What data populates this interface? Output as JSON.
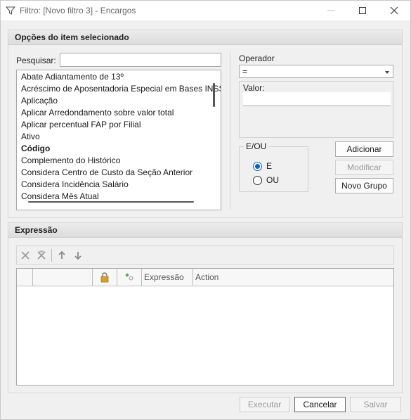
{
  "window": {
    "title": "Filtro: [Novo filtro 3] - Encargos"
  },
  "options_panel": {
    "header": "Opções do item selecionado",
    "search_label": "Pesquisar:",
    "search_value": "",
    "items": [
      {
        "label": "Abate Adiantamento de 13º",
        "bold": false
      },
      {
        "label": "Acréscimo de Aposentadoria Especial em Bases INSS",
        "bold": false
      },
      {
        "label": "Aplicação",
        "bold": false
      },
      {
        "label": "Aplicar Arredondamento sobre valor total",
        "bold": false
      },
      {
        "label": "Aplicar percentual FAP por Filial",
        "bold": false
      },
      {
        "label": "Ativo",
        "bold": false
      },
      {
        "label": "Código",
        "bold": true
      },
      {
        "label": "Complemento do Histórico",
        "bold": false
      },
      {
        "label": "Considera Centro de Custo da Seção Anterior",
        "bold": false
      },
      {
        "label": "Considera Incidência Salário",
        "bold": false
      },
      {
        "label": "Considera Mês Atual",
        "bold": false
      }
    ],
    "operator_label": "Operador",
    "operator_value": "=",
    "valor_label": "Valor:",
    "valor_value": "",
    "eou": {
      "title": "E/OU",
      "options": [
        "E",
        "OU"
      ],
      "selected": "E"
    },
    "buttons": {
      "adicionar": "Adicionar",
      "modificar": "Modificar",
      "novo_grupo": "Novo Grupo"
    }
  },
  "expression_panel": {
    "header": "Expressão",
    "columns": [
      "",
      "",
      "lock-icon",
      "toggle-icon",
      "Expressão",
      "Action"
    ],
    "rows": []
  },
  "footer": {
    "executar": "Executar",
    "cancelar": "Cancelar",
    "salvar": "Salvar"
  },
  "colors": {
    "accent": "#0a64c8",
    "disabled_text": "#9a9a9a",
    "lock": "#d7a02a"
  }
}
